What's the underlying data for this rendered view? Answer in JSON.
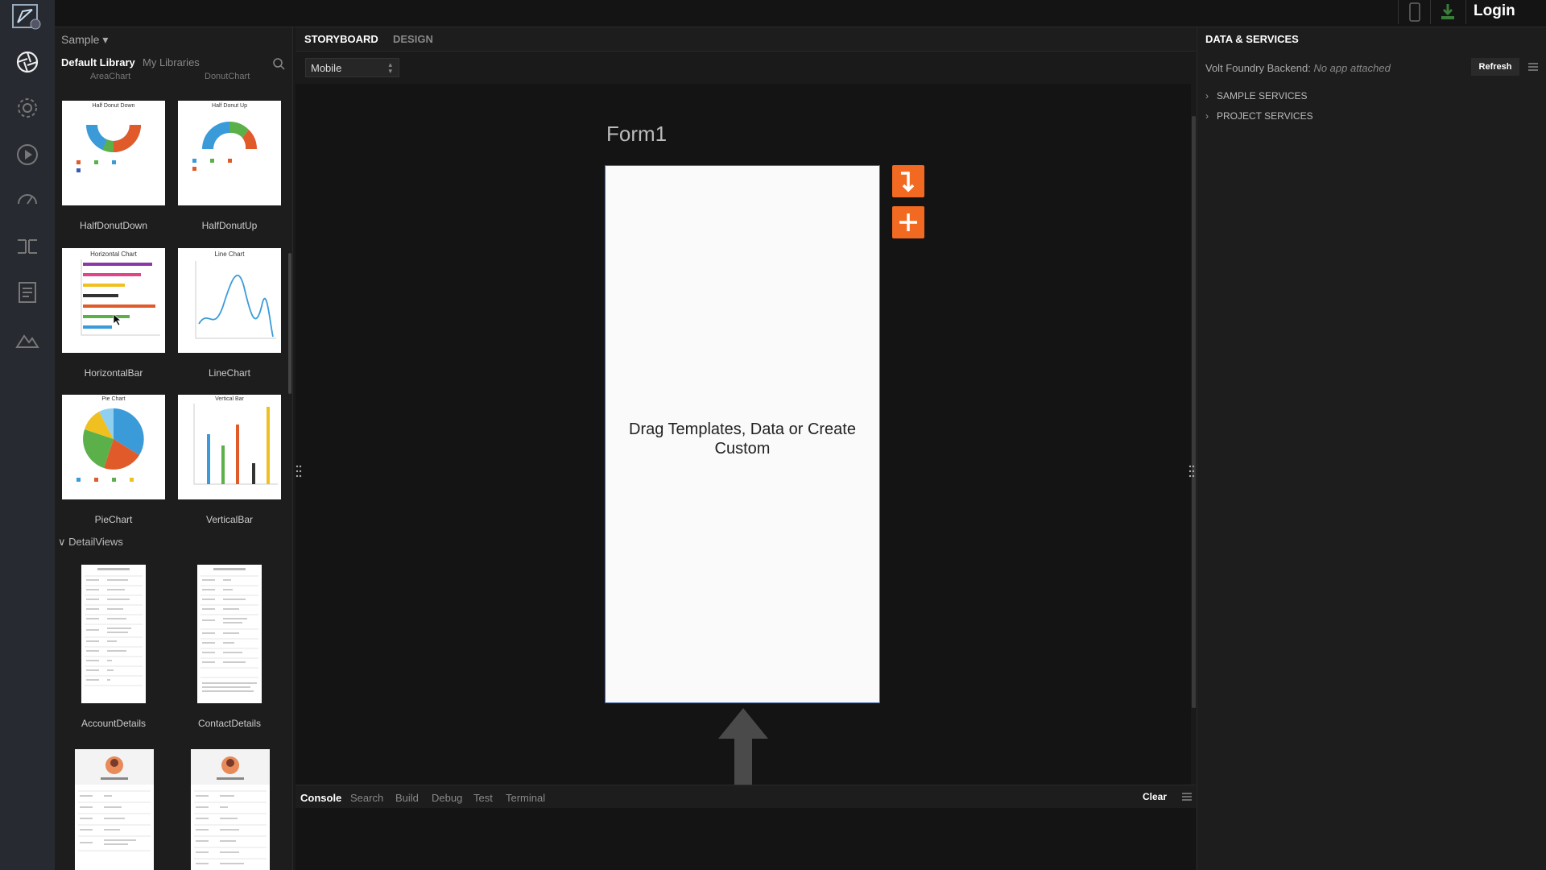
{
  "topbar": {
    "login_label": "Login"
  },
  "library": {
    "project": "Sample",
    "tabs": [
      "Default Library",
      "My Libraries"
    ],
    "cut_labels": [
      "AreaChart",
      "DonutChart"
    ],
    "charts": [
      {
        "label": "HalfDonutDown",
        "thumb_title": "Half Donut Down"
      },
      {
        "label": "HalfDonutUp",
        "thumb_title": "Half Donut Up"
      },
      {
        "label": "HorizontalBar",
        "thumb_title": "Horizontal Chart"
      },
      {
        "label": "LineChart",
        "thumb_title": "Line Chart"
      },
      {
        "label": "PieChart",
        "thumb_title": "Pie Chart"
      },
      {
        "label": "VerticalBar",
        "thumb_title": "Vertical Bar"
      }
    ],
    "section": "DetailViews",
    "details": [
      {
        "label": "AccountDetails"
      },
      {
        "label": "ContactDetails"
      }
    ]
  },
  "center": {
    "tabs": [
      "STORYBOARD",
      "DESIGN"
    ],
    "device": "Mobile",
    "form_title": "Form1",
    "hint": "Drag Templates, Data or Create Custom"
  },
  "console": {
    "tabs": [
      "Console",
      "Search",
      "Build",
      "Debug",
      "Test",
      "Terminal"
    ],
    "clear_label": "Clear"
  },
  "data_services": {
    "title": "DATA & SERVICES",
    "backend_label": "Volt Foundry Backend:",
    "backend_value": "No app attached",
    "refresh_label": "Refresh",
    "sections": [
      "SAMPLE SERVICES",
      "PROJECT SERVICES"
    ]
  },
  "colors": {
    "accent": "#f26a22",
    "form_border": "#4466aa"
  }
}
